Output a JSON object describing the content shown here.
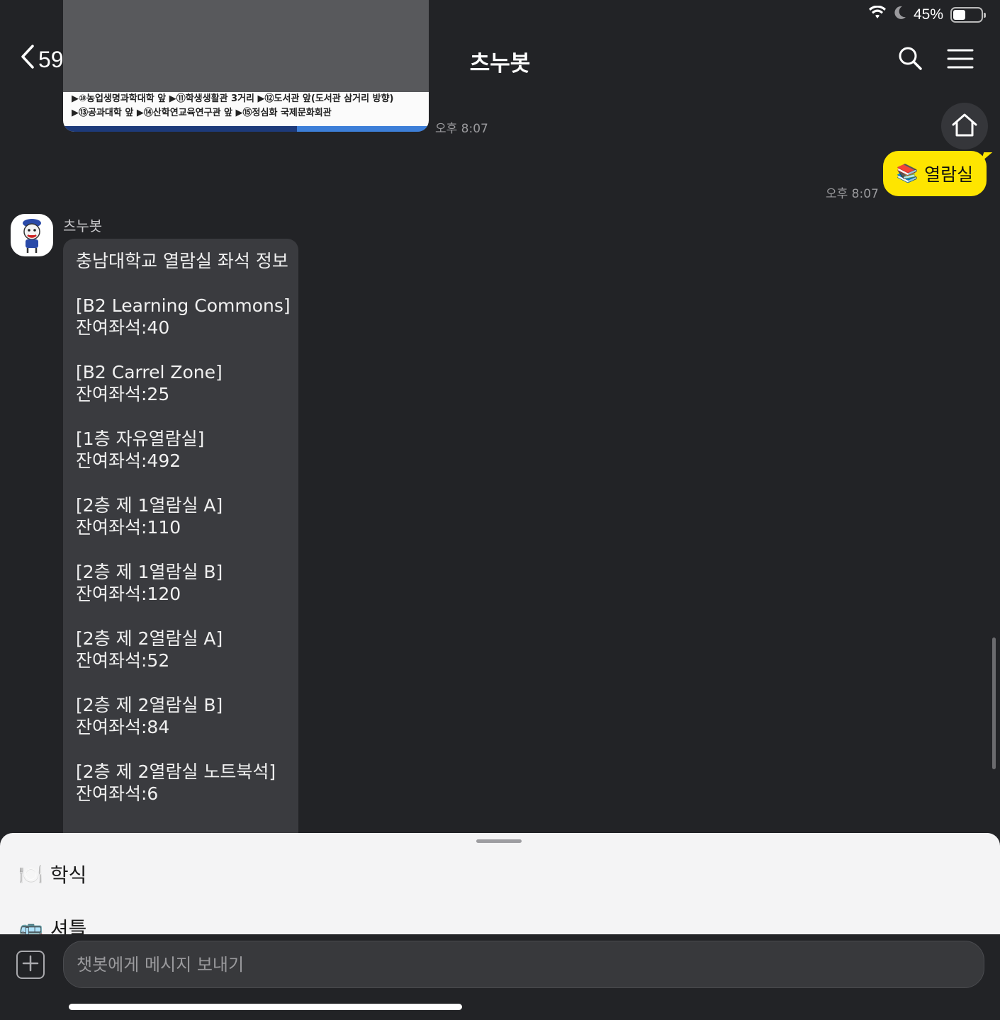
{
  "status": {
    "battery": "45%",
    "battery_level": 0.45
  },
  "header": {
    "back_count": "59",
    "title": "츠누봇"
  },
  "image_card": {
    "line1": "▶⑩농업생명과학대학 앞 ▶⑪학생생활관 3거리 ▶⑫도서관 앞(도서관 삼거리 방향)",
    "line2": "▶⑬공과대학 앞 ▶⑭산학연교육연구관 앞 ▶⑮정심화 국제문화회관",
    "time": "오후 8:07"
  },
  "user_message": {
    "emoji": "📚",
    "text": "열람실",
    "time": "오후 8:07"
  },
  "bot": {
    "name": "츠누봇",
    "heading": "충남대학교 열람실 좌석 정보",
    "rooms": [
      {
        "name": "[B2 Learning Commons]",
        "seats": "잔여좌석:40"
      },
      {
        "name": "[B2 Carrel Zone]",
        "seats": "잔여좌석:25"
      },
      {
        "name": "[1층 자유열람실]",
        "seats": "잔여좌석:492"
      },
      {
        "name": "[2층 제 1열람실 A]",
        "seats": "잔여좌석:110"
      },
      {
        "name": "[2층 제 1열람실 B]",
        "seats": "잔여좌석:120"
      },
      {
        "name": "[2층 제 2열람실 A]",
        "seats": "잔여좌석:52"
      },
      {
        "name": "[2층 제 2열람실 B]",
        "seats": "잔여좌석:84"
      },
      {
        "name": "[2층 제 2열람실 노트북석]",
        "seats": "잔여좌석:6"
      }
    ]
  },
  "quick_replies": [
    {
      "emoji": "🍽️",
      "label": "학식"
    },
    {
      "emoji": "🚌",
      "label": "셔틀"
    }
  ],
  "input": {
    "placeholder": "챗봇에게 메시지 보내기"
  },
  "colors": {
    "accent": "#fee500",
    "background": "#222326",
    "bubble": "#3a3b3f"
  }
}
